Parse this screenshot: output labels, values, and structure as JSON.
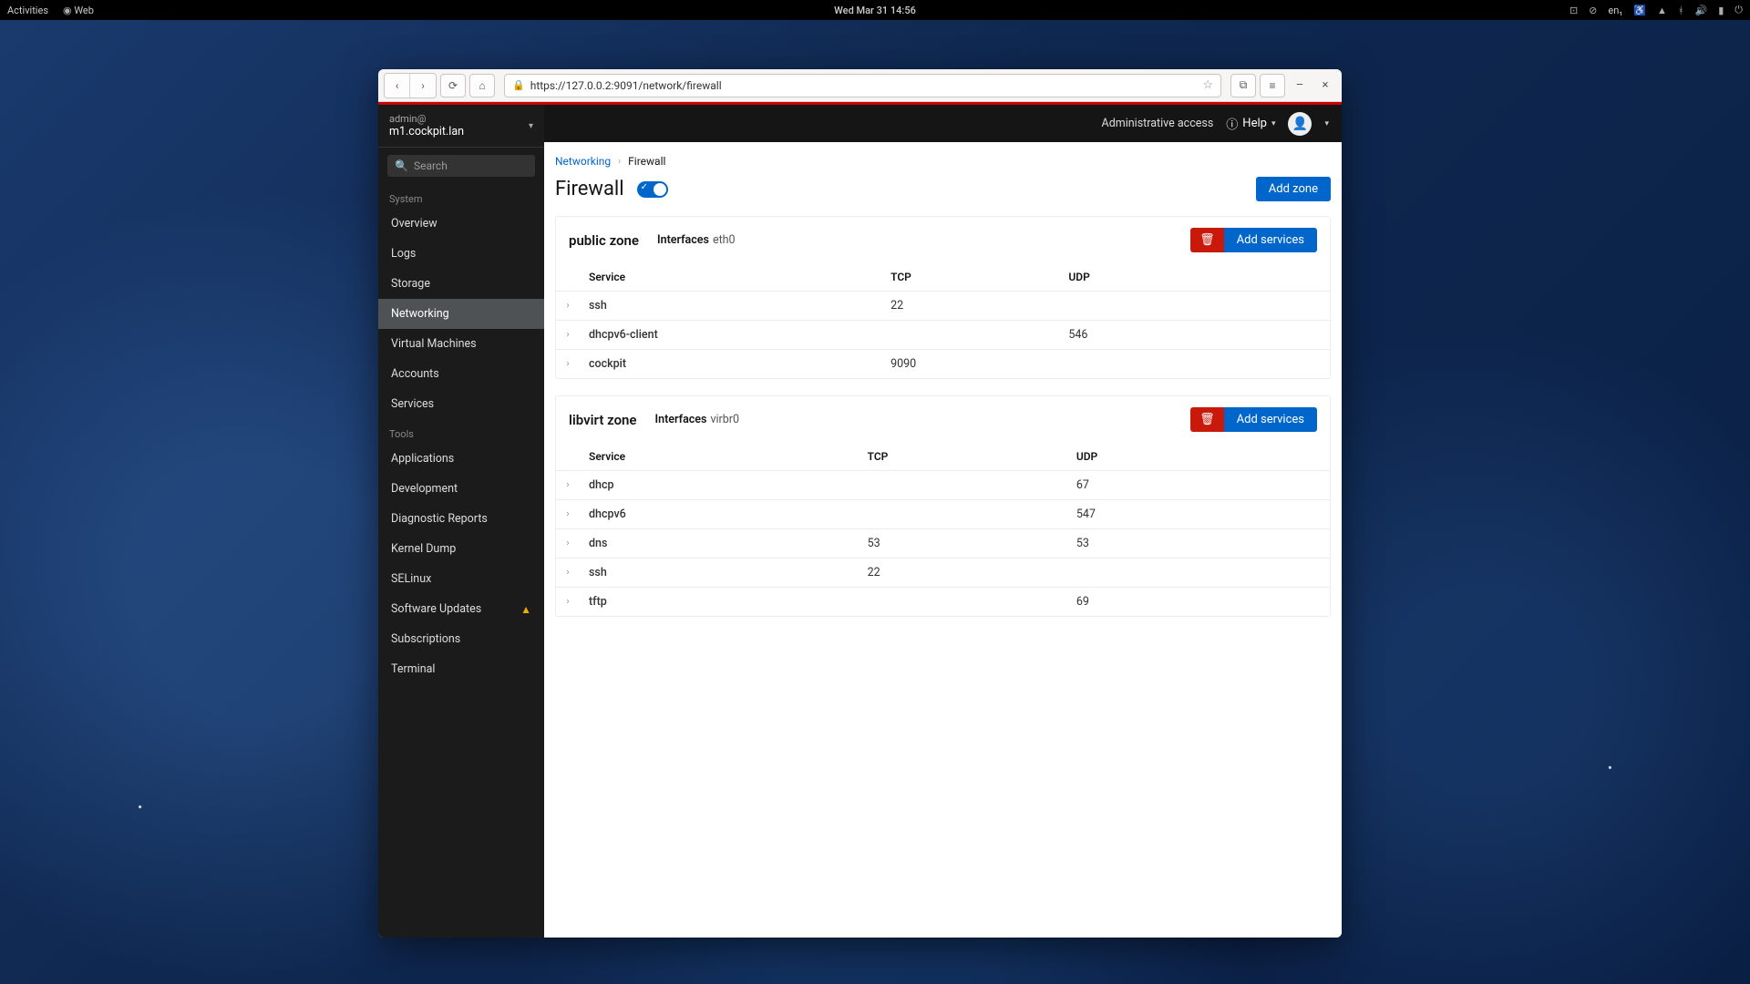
{
  "topbar": {
    "activities": "Activities",
    "app": "Web",
    "datetime": "Wed Mar 31  14:56",
    "lang": "en₁"
  },
  "browser": {
    "url": "https://127.0.0.2:9091/network/firewall"
  },
  "sidebar": {
    "user": "admin@",
    "host": "m1.cockpit.lan",
    "search_placeholder": "Search",
    "section_system": "System",
    "section_tools": "Tools",
    "items_system": [
      {
        "label": "Overview"
      },
      {
        "label": "Logs"
      },
      {
        "label": "Storage"
      },
      {
        "label": "Networking",
        "active": true
      },
      {
        "label": "Virtual Machines"
      },
      {
        "label": "Accounts"
      },
      {
        "label": "Services"
      }
    ],
    "items_tools": [
      {
        "label": "Applications"
      },
      {
        "label": "Development"
      },
      {
        "label": "Diagnostic Reports"
      },
      {
        "label": "Kernel Dump"
      },
      {
        "label": "SELinux"
      },
      {
        "label": "Software Updates",
        "warn": true
      },
      {
        "label": "Subscriptions"
      },
      {
        "label": "Terminal"
      }
    ]
  },
  "header": {
    "admin_access": "Administrative access",
    "help": "Help"
  },
  "breadcrumb": {
    "parent": "Networking",
    "current": "Firewall"
  },
  "page": {
    "title": "Firewall",
    "add_zone": "Add zone"
  },
  "labels": {
    "interfaces": "Interfaces",
    "add_services": "Add services",
    "col_service": "Service",
    "col_tcp": "TCP",
    "col_udp": "UDP"
  },
  "zones": [
    {
      "name": "public zone",
      "interface": "eth0",
      "services": [
        {
          "name": "ssh",
          "tcp": "22",
          "udp": ""
        },
        {
          "name": "dhcpv6-client",
          "tcp": "",
          "udp": "546"
        },
        {
          "name": "cockpit",
          "tcp": "9090",
          "udp": ""
        }
      ]
    },
    {
      "name": "libvirt zone",
      "interface": "virbr0",
      "services": [
        {
          "name": "dhcp",
          "tcp": "",
          "udp": "67"
        },
        {
          "name": "dhcpv6",
          "tcp": "",
          "udp": "547"
        },
        {
          "name": "dns",
          "tcp": "53",
          "udp": "53"
        },
        {
          "name": "ssh",
          "tcp": "22",
          "udp": ""
        },
        {
          "name": "tftp",
          "tcp": "",
          "udp": "69"
        }
      ]
    }
  ]
}
